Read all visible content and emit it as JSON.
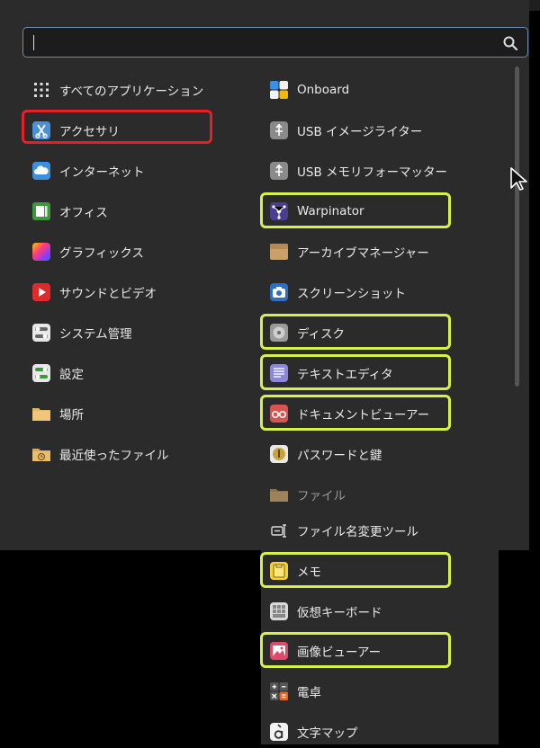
{
  "search": {
    "value": "",
    "placeholder": ""
  },
  "categories": [
    {
      "label": "すべてのアプリケーション",
      "icon": "grid-icon"
    },
    {
      "label": "アクセサリ",
      "icon": "accessories-icon"
    },
    {
      "label": "インターネット",
      "icon": "internet-cloud-icon"
    },
    {
      "label": "オフィス",
      "icon": "office-icon"
    },
    {
      "label": "グラフィックス",
      "icon": "graphics-icon"
    },
    {
      "label": "サウンドとビデオ",
      "icon": "sound-video-icon"
    },
    {
      "label": "システム管理",
      "icon": "system-admin-icon"
    },
    {
      "label": "設定",
      "icon": "settings-icon"
    },
    {
      "label": "場所",
      "icon": "folder-icon"
    },
    {
      "label": "最近使ったファイル",
      "icon": "recent-files-icon"
    }
  ],
  "apps": [
    {
      "label": "Onboard",
      "icon": "onboard-icon"
    },
    {
      "label": "USB イメージライター",
      "icon": "usb-image-writer-icon"
    },
    {
      "label": "USB メモリフォーマッター",
      "icon": "usb-formatter-icon"
    },
    {
      "label": "Warpinator",
      "icon": "warpinator-icon"
    },
    {
      "label": "アーカイブマネージャー",
      "icon": "archive-manager-icon"
    },
    {
      "label": "スクリーンショット",
      "icon": "screenshot-icon"
    },
    {
      "label": "ディスク",
      "icon": "disk-icon"
    },
    {
      "label": "テキストエディタ",
      "icon": "text-editor-icon"
    },
    {
      "label": "ドキュメントビューアー",
      "icon": "document-viewer-icon"
    },
    {
      "label": "パスワードと鍵",
      "icon": "passwords-keys-icon"
    },
    {
      "label": "ファイル",
      "icon": "files-icon"
    },
    {
      "label": "ファイル名変更ツール",
      "icon": "rename-tool-icon"
    },
    {
      "label": "メモ",
      "icon": "notes-icon"
    },
    {
      "label": "仮想キーボード",
      "icon": "virtual-keyboard-icon"
    },
    {
      "label": "画像ビューアー",
      "icon": "image-viewer-icon"
    },
    {
      "label": "電卓",
      "icon": "calculator-icon"
    },
    {
      "label": "文字マップ",
      "icon": "character-map-icon"
    }
  ],
  "colors": {
    "panel": "#2b2b2b",
    "selection_red": "#e5202a",
    "highlight_yellow": "#d6f14a",
    "search_border": "#6a8fb5"
  }
}
